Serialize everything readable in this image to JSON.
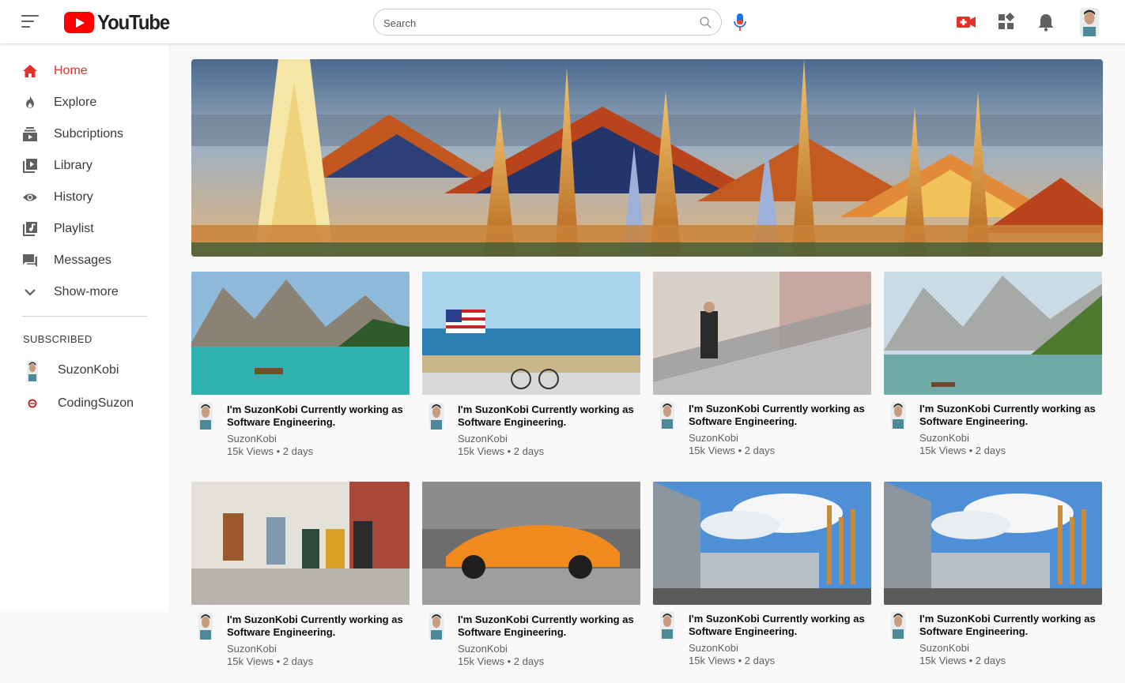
{
  "header": {
    "logo_text": "YouTube",
    "search_placeholder": "Search"
  },
  "sidebar": {
    "items": [
      {
        "label": "Home",
        "icon": "home-icon",
        "active": true
      },
      {
        "label": "Explore",
        "icon": "explore-icon",
        "active": false
      },
      {
        "label": "Subcriptions",
        "icon": "subscriptions-icon",
        "active": false
      },
      {
        "label": "Library",
        "icon": "library-icon",
        "active": false
      },
      {
        "label": "History",
        "icon": "history-icon",
        "active": false
      },
      {
        "label": "Playlist",
        "icon": "playlist-icon",
        "active": false
      },
      {
        "label": "Messages",
        "icon": "messages-icon",
        "active": false
      },
      {
        "label": "Show-more",
        "icon": "chevron-down-icon",
        "active": false
      }
    ],
    "subscribed_heading": "SUBSCRIBED",
    "subscriptions": [
      {
        "name": "SuzonKobi"
      },
      {
        "name": "CodingSuzon"
      }
    ]
  },
  "videos": [
    {
      "title": "I'm SuzonKobi Currently working as Software Engineering.",
      "channel": "SuzonKobi",
      "stats": "15k Views • 2 days",
      "thumbnail": "mountain-lake"
    },
    {
      "title": "I'm SuzonKobi Currently working as Software Engineering.",
      "channel": "SuzonKobi",
      "stats": "15k Views • 2 days",
      "thumbnail": "beach-flag"
    },
    {
      "title": "I'm SuzonKobi Currently working as Software Engineering.",
      "channel": "SuzonKobi",
      "stats": "15k Views • 2 days",
      "thumbnail": "escalator"
    },
    {
      "title": "I'm SuzonKobi Currently working as Software Engineering.",
      "channel": "SuzonKobi",
      "stats": "15k Views • 2 days",
      "thumbnail": "alpine-lake"
    },
    {
      "title": "I'm SuzonKobi Currently working as Software Engineering.",
      "channel": "SuzonKobi",
      "stats": "15k Views • 2 days",
      "thumbnail": "friends-walking"
    },
    {
      "title": "I'm SuzonKobi Currently working as Software Engineering.",
      "channel": "SuzonKobi",
      "stats": "15k Views • 2 days",
      "thumbnail": "orange-sports-car"
    },
    {
      "title": "I'm SuzonKobi Currently working as Software Engineering.",
      "channel": "SuzonKobi",
      "stats": "15k Views • 2 days",
      "thumbnail": "campus-building"
    },
    {
      "title": "I'm SuzonKobi Currently working as Software Engineering.",
      "channel": "SuzonKobi",
      "stats": "15k Views • 2 days",
      "thumbnail": "campus-building"
    }
  ],
  "colors": {
    "accent": "#e0322b",
    "brand_red": "#ff0000"
  }
}
